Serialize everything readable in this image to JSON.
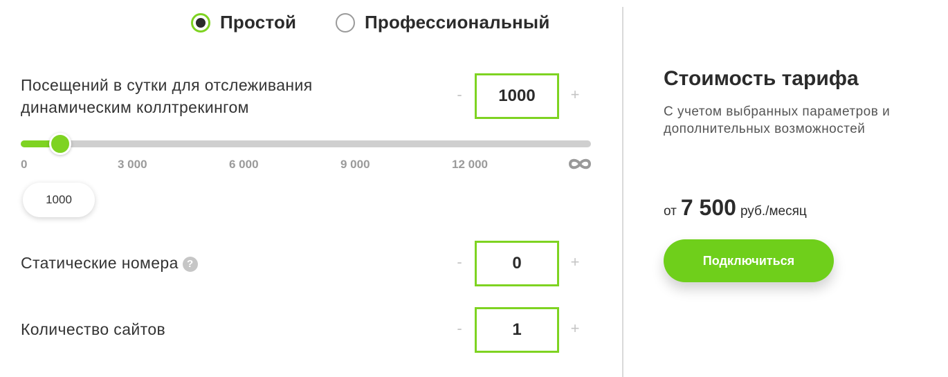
{
  "mode": {
    "options": [
      {
        "label": "Простой",
        "checked": true
      },
      {
        "label": "Профессиональный",
        "checked": false
      }
    ]
  },
  "visits": {
    "label": "Посещений в сутки для отслеживания динамическим коллтрекингом",
    "value": "1000",
    "minus": "-",
    "plus": "+",
    "slider": {
      "value": 1000,
      "max": 15000,
      "ticks": [
        "0",
        "3 000",
        "6 000",
        "9 000",
        "12 000"
      ],
      "infinity_icon": "infinity-icon",
      "tooltip": "1000"
    }
  },
  "static_numbers": {
    "label": "Статические номера",
    "help": "?",
    "value": "0",
    "minus": "-",
    "plus": "+"
  },
  "sites": {
    "label": "Количество сайтов",
    "value": "1",
    "minus": "-",
    "plus": "+"
  },
  "tariff": {
    "title": "Стоимость тарифа",
    "description": "С учетом выбранных параметров и дополнительных возможностей",
    "price_prefix": "от",
    "price": "7 500",
    "price_suffix": "руб./месяц",
    "button": "Подключиться"
  },
  "colors": {
    "accent": "#7ed321",
    "button": "#6fcf1b",
    "track": "#cfcfcf",
    "muted": "#9a9a9a"
  }
}
